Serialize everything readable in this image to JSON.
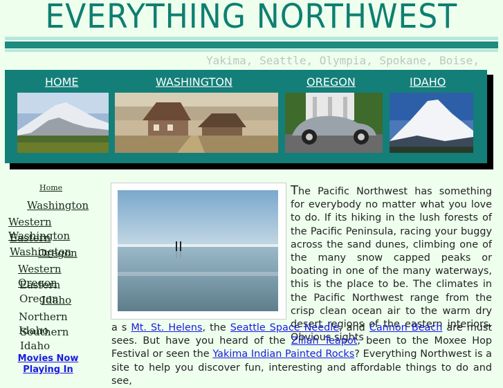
{
  "header": {
    "title": "EVERYTHING NORTHWEST",
    "cities": "Yakima, Seattle, Olympia, Spokane, Boise,"
  },
  "nav": {
    "home": "HOME",
    "washington": "WASHINGTON",
    "oregon": "OREGON",
    "idaho": "IDAHO"
  },
  "sidebar": {
    "home": "Home",
    "washington": "Washington",
    "western_washington": "Western Washington",
    "eastern_washington": "Eastern Washington",
    "oregon": "Oregon",
    "western_oregon": "Western Oregon",
    "eastern_oregon": "Eastern Oregon",
    "idaho": "Idaho",
    "northern_idaho": "Northern Idaho",
    "southern_idaho": "Southern Idaho",
    "movies": "Movies Now Playing In"
  },
  "content": {
    "dropcap": "T",
    "intro": "he Pacific Northwest has something for everybody no matter what you love to do.  If its hiking in the lush forests of the Pacific Peninsula, racing your buggy across the sand dunes, climbing one of the many snow capped peaks or boating in one of the many waterways, this is the place to be.  The climates in the Pacific Northwest range from the crisp clean ocean air to the warm dry desert regions of the eastern interiors.  Obvious sights",
    "p2_a": "a s ",
    "link_helens": "Mt. St. Helens",
    "p2_b": ",  the ",
    "link_needle": "Seattle Space Needle",
    "p2_c": ",  and ",
    "link_cannon": "Cannon Beach",
    "p2_d": " are must sees.  But have you heard of the ",
    "link_teapot": "Zillah Teapot",
    "p2_e": ", been to the Moxee Hop Festival or seen the ",
    "link_rocks": "Yakima Indian Painted Rocks",
    "p2_f": "?  Everything Northwest is a site to help you discover fun, interesting and affordable things to do and see,"
  },
  "colors": {
    "background": "#eeffee",
    "teal": "#137f78",
    "title": "#0e7f70",
    "link": "#1a1ae0"
  }
}
